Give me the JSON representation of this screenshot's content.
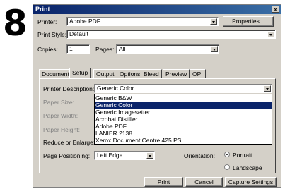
{
  "step_number": "8",
  "window": {
    "title": "Print",
    "close_label": "x"
  },
  "printer": {
    "label": "Printer:",
    "value": "Adobe PDF",
    "properties_button": "Properties..."
  },
  "print_style": {
    "label": "Print Style:",
    "value": "Default"
  },
  "copies": {
    "label": "Copies:",
    "value": "1"
  },
  "pages": {
    "label": "Pages:",
    "value": "All"
  },
  "tabs": [
    "Document",
    "Setup",
    "Output",
    "Options",
    "Bleed",
    "Preview",
    "OPI"
  ],
  "active_tab": "Setup",
  "setup": {
    "printer_description": {
      "label": "Printer Description:",
      "value": "Generic Color"
    },
    "paper_size_label": "Paper Size:",
    "paper_width_label": "Paper Width:",
    "paper_height_label": "Paper Height:",
    "reduce_label": "Reduce or Enlarge:",
    "page_positioning": {
      "label": "Page Positioning:",
      "value": "Left Edge"
    },
    "orientation": {
      "label": "Orientation:",
      "options": [
        "Portrait",
        "Landscape"
      ],
      "selected": "Portrait"
    }
  },
  "printer_description_options": [
    "Generic B&W",
    "Generic Color",
    "Generic Imagesetter",
    "Acrobat Distiller",
    "Adobe PDF",
    "LANIER 2138",
    "Xerox Document Centre 425 PS"
  ],
  "printer_description_selected": "Generic Color",
  "footer": {
    "print_button": "Print",
    "cancel_button": "Cancel",
    "capture_button": "Capture Settings"
  }
}
